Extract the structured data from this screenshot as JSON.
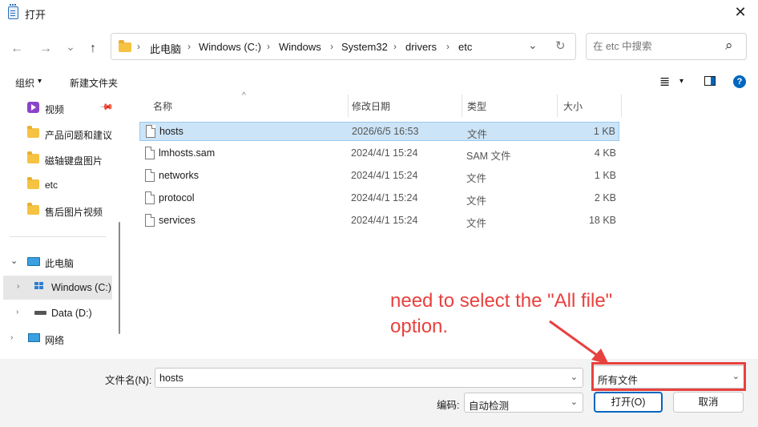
{
  "window": {
    "title": "打开",
    "close": "✕"
  },
  "nav": {
    "back": "←",
    "forward": "→",
    "dropdown": "⌄",
    "up": "↑"
  },
  "address": {
    "crumbs": [
      "此电脑",
      "Windows (C:)",
      "Windows",
      "System32",
      "drivers",
      "etc"
    ],
    "separator": "›",
    "dropdown": "⌄",
    "refresh": "↻"
  },
  "search": {
    "placeholder": "在 etc 中搜索",
    "icon": "⌕"
  },
  "toolbar": {
    "organize": "组织",
    "organize_caret": "▾",
    "new_folder": "新建文件夹",
    "view_icon": "≣",
    "view_caret": "▾",
    "help": "?"
  },
  "sidebar": {
    "quick": [
      {
        "label": "视频",
        "pin": true
      },
      {
        "label": "产品问题和建议"
      },
      {
        "label": "磁轴键盘图片"
      },
      {
        "label": "etc"
      },
      {
        "label": "售后图片视频"
      }
    ],
    "tree": [
      {
        "label": "此电脑",
        "expanded": true
      },
      {
        "label": "Windows (C:)",
        "selected": true
      },
      {
        "label": "Data (D:)"
      },
      {
        "label": "网络"
      }
    ]
  },
  "columns": {
    "name": "名称",
    "modified": "修改日期",
    "type": "类型",
    "size": "大小"
  },
  "files": [
    {
      "name": "hosts",
      "modified": "2026/6/5 16:53",
      "type": "文件",
      "size": "1 KB",
      "selected": true
    },
    {
      "name": "lmhosts.sam",
      "modified": "2024/4/1 15:24",
      "type": "SAM 文件",
      "size": "4 KB"
    },
    {
      "name": "networks",
      "modified": "2024/4/1 15:24",
      "type": "文件",
      "size": "1 KB"
    },
    {
      "name": "protocol",
      "modified": "2024/4/1 15:24",
      "type": "文件",
      "size": "2 KB"
    },
    {
      "name": "services",
      "modified": "2024/4/1 15:24",
      "type": "文件",
      "size": "18 KB"
    }
  ],
  "bottom": {
    "filename_label": "文件名(N):",
    "filename_value": "hosts",
    "filter_value": "所有文件",
    "encoding_label": "编码:",
    "encoding_value": "自动检测",
    "open_button": "打开(O)",
    "cancel_button": "取消"
  },
  "annotation": {
    "text": "need to select the \"All file\" option.",
    "color": "#e8413e"
  }
}
